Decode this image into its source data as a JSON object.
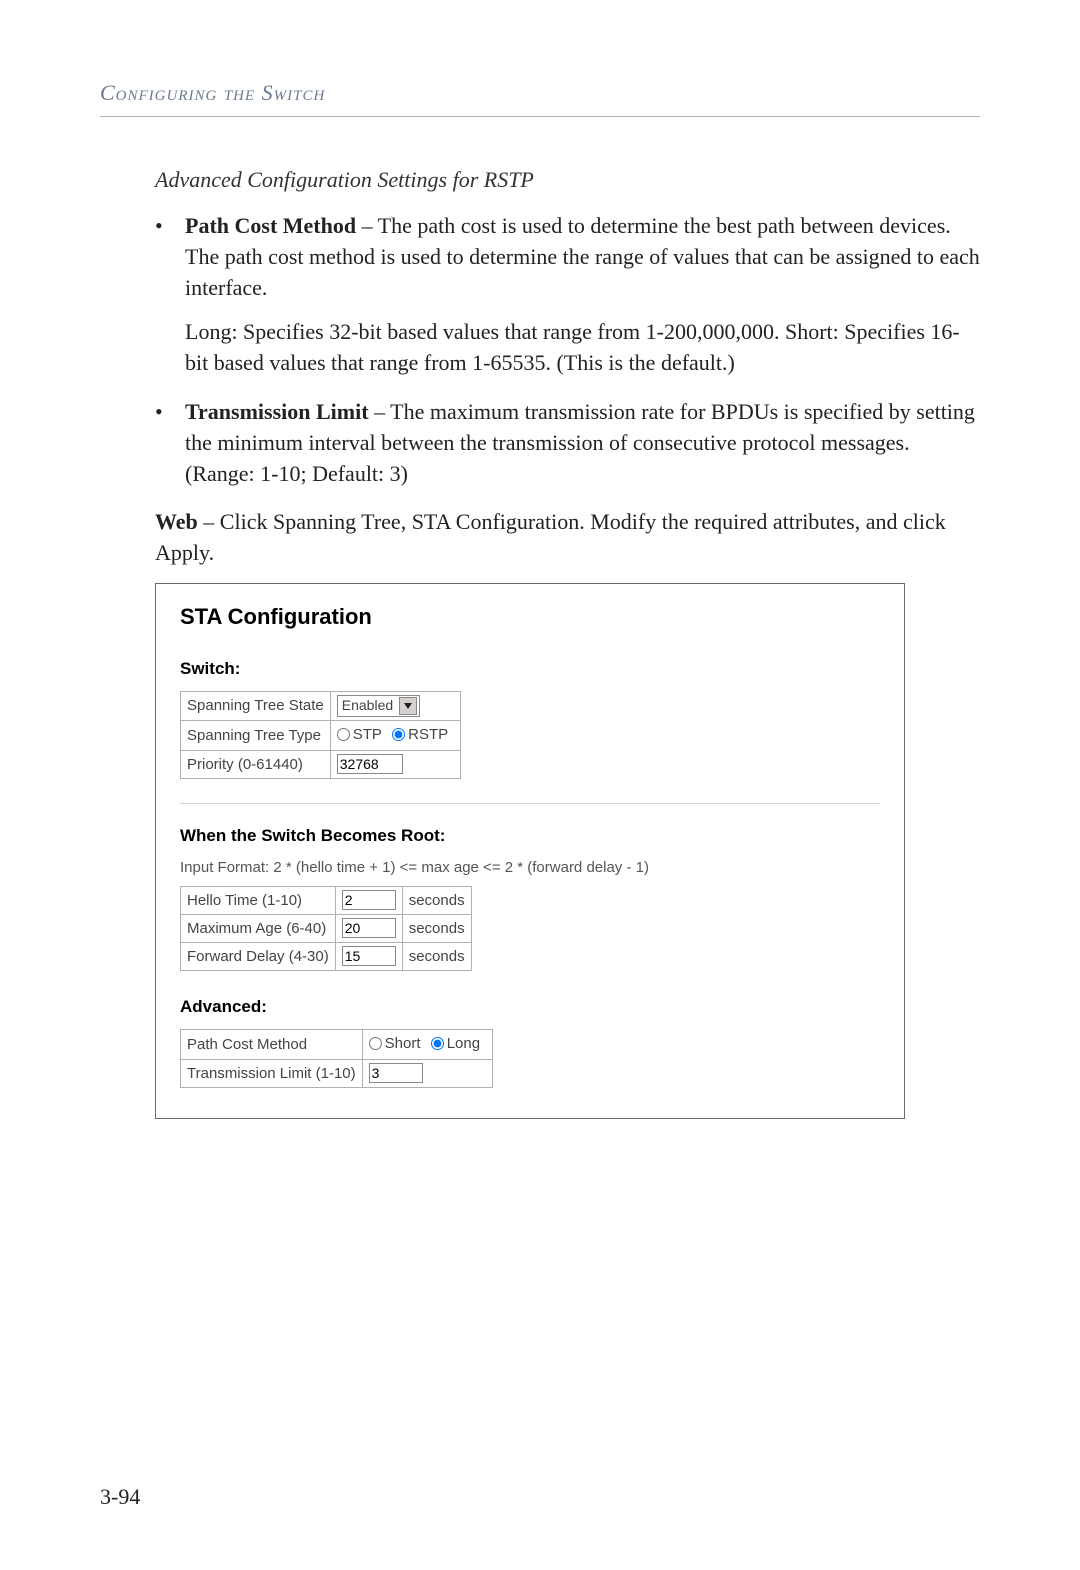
{
  "header": "Configuring the Switch",
  "subtitle": "Advanced Configuration Settings for RSTP",
  "bullets": [
    {
      "title": "Path Cost Method",
      "text": " – The path cost is used to determine the best path between devices. The path cost method is used to determine the range of values that can be assigned to each interface.",
      "sub": "Long: Specifies 32-bit based values that range from 1-200,000,000. Short: Specifies 16-bit based values that range from 1-65535. (This is the default.)"
    },
    {
      "title": "Transmission Limit",
      "text": " – The maximum transmission rate for BPDUs is specified by setting the minimum interval between the transmission of consecutive protocol messages. (Range: 1-10; Default: 3)",
      "sub": ""
    }
  ],
  "web_lead": "Web",
  "web_text": " – Click Spanning Tree, STA Configuration. Modify the required attributes, and click Apply.",
  "screenshot": {
    "title": "STA Configuration",
    "switch_header": "Switch:",
    "switch_rows": {
      "state_label": "Spanning Tree State",
      "state_value": "Enabled",
      "type_label": "Spanning Tree Type",
      "type_opt1": "STP",
      "type_opt2": "RSTP",
      "priority_label": "Priority (0-61440)",
      "priority_value": "32768"
    },
    "root_header": "When the Switch Becomes Root:",
    "root_hint": "Input Format: 2 * (hello time + 1) <= max age <= 2 * (forward delay - 1)",
    "root_rows": {
      "hello_label": "Hello Time (1-10)",
      "hello_value": "2",
      "maxage_label": "Maximum Age (6-40)",
      "maxage_value": "20",
      "fwd_label": "Forward Delay (4-30)",
      "fwd_value": "15",
      "unit": "seconds"
    },
    "advanced_header": "Advanced:",
    "advanced_rows": {
      "pcm_label": "Path Cost Method",
      "pcm_opt1": "Short",
      "pcm_opt2": "Long",
      "trans_label": "Transmission Limit (1-10)",
      "trans_value": "3"
    }
  },
  "page_number": "3-94"
}
